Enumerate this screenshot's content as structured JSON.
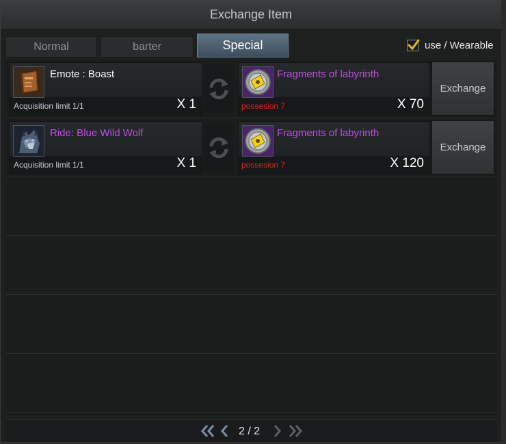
{
  "window": {
    "title": "Exchange Item"
  },
  "tabs": [
    {
      "label": "Normal",
      "active": false
    },
    {
      "label": "barter",
      "active": false
    },
    {
      "label": "Special",
      "active": true
    }
  ],
  "filter": {
    "label": "use / Wearable",
    "checked": true
  },
  "rows": [
    {
      "reward": {
        "name": "Emote : Boast",
        "icon": "book-icon",
        "limit": "Acquisition limit 1/1",
        "qty": "X 1",
        "name_color": "#ffffff"
      },
      "cost": {
        "name": "Fragments of labyrinth",
        "icon": "labyrinth-coin-icon",
        "possession": "possesion 7",
        "qty": "X 70"
      },
      "button": "Exchange"
    },
    {
      "reward": {
        "name": "Ride: Blue Wild Wolf",
        "icon": "wolf-icon",
        "limit": "Acquisition limit 1/1",
        "qty": "X 1",
        "name_color": "#c24de3"
      },
      "cost": {
        "name": "Fragments of labyrinth",
        "icon": "labyrinth-coin-icon",
        "possession": "possesion 7",
        "qty": "X 120"
      },
      "button": "Exchange"
    }
  ],
  "pagination": {
    "current": "2 / 2"
  },
  "colors": {
    "accent_tab": "#4f6375",
    "purple_name": "#c24de3",
    "possession_red": "#e42020"
  }
}
